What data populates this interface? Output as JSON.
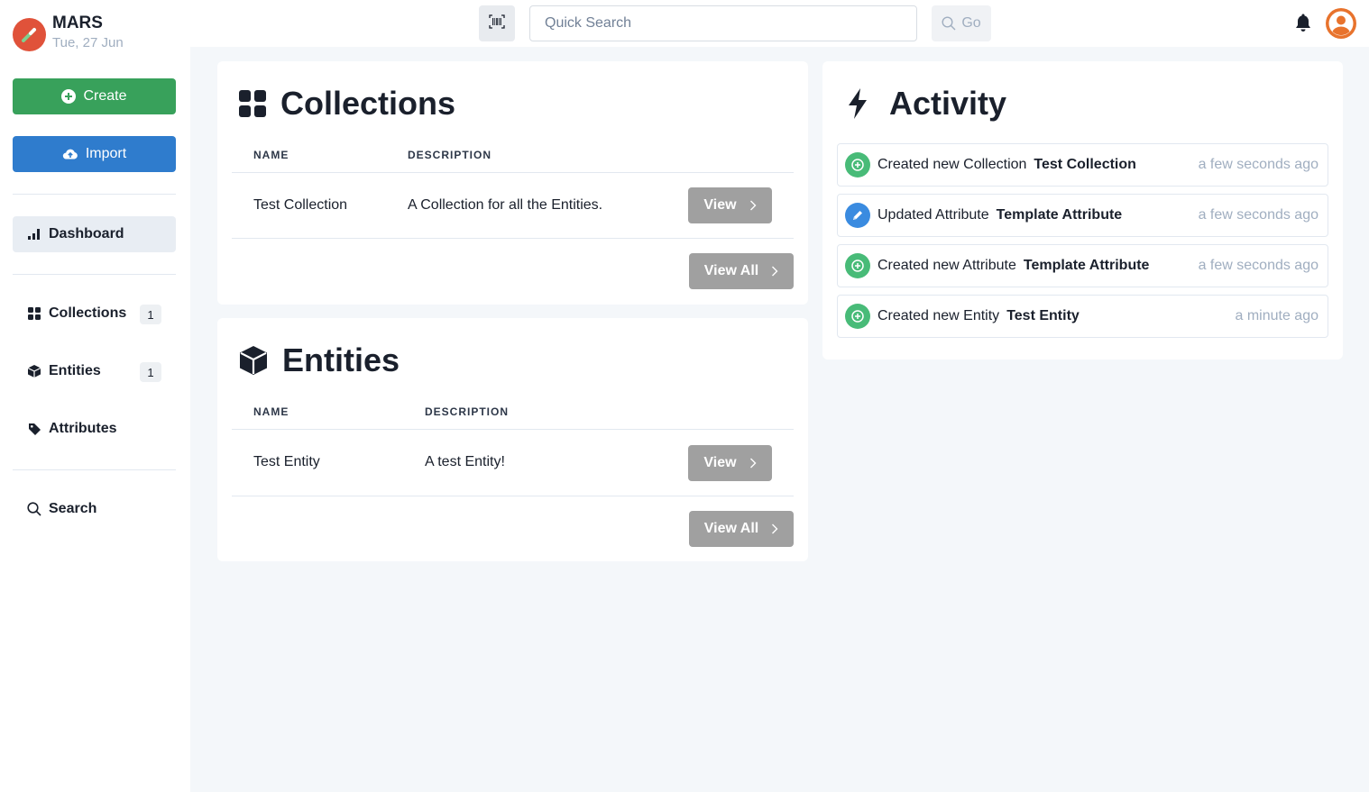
{
  "app": {
    "name": "MARS",
    "date": "Tue, 27 Jun"
  },
  "sidebar": {
    "create_label": "Create",
    "import_label": "Import",
    "dashboard_label": "Dashboard",
    "items": [
      {
        "label": "Collections",
        "count": "1"
      },
      {
        "label": "Entities",
        "count": "1"
      },
      {
        "label": "Attributes"
      }
    ],
    "search_label": "Search"
  },
  "topbar": {
    "search_placeholder": "Quick Search",
    "go_label": "Go"
  },
  "collections": {
    "title": "Collections",
    "col_name": "NAME",
    "col_description": "DESCRIPTION",
    "rows": [
      {
        "name": "Test Collection",
        "description": "A Collection for all the Entities.",
        "view_label": "View"
      }
    ],
    "view_all_label": "View All"
  },
  "entities": {
    "title": "Entities",
    "col_name": "NAME",
    "col_description": "DESCRIPTION",
    "rows": [
      {
        "name": "Test Entity",
        "description": "A test Entity!",
        "view_label": "View"
      }
    ],
    "view_all_label": "View All"
  },
  "activity": {
    "title": "Activity",
    "items": [
      {
        "type": "create",
        "action": "Created new Collection",
        "target": "Test Collection",
        "time": "a few seconds ago"
      },
      {
        "type": "update",
        "action": "Updated Attribute",
        "target": "Template Attribute",
        "time": "a few seconds ago"
      },
      {
        "type": "create",
        "action": "Created new Attribute",
        "target": "Template Attribute",
        "time": "a few seconds ago"
      },
      {
        "type": "create",
        "action": "Created new Entity",
        "target": "Test Entity",
        "time": "a minute ago"
      }
    ]
  },
  "colors": {
    "create_green": "#38a15b",
    "import_blue": "#2f7ccd",
    "avatar_orange": "#e8732d",
    "logo_red": "#e0523a"
  }
}
